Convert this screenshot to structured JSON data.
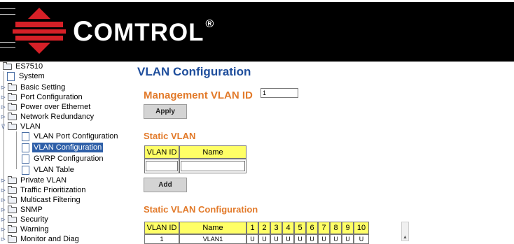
{
  "header": {
    "brand_initial": "C",
    "brand_rest": "OMTROL",
    "brand_mark": "®"
  },
  "tree": {
    "root": "ES7510",
    "items": [
      {
        "label": "System",
        "icon": "page-icon"
      },
      {
        "label": "Basic Setting",
        "icon": "folder-icon"
      },
      {
        "label": "Port Configuration",
        "icon": "folder-icon"
      },
      {
        "label": "Power over Ethernet",
        "icon": "folder-icon"
      },
      {
        "label": "Network Redundancy",
        "icon": "folder-icon"
      },
      {
        "label": "VLAN",
        "icon": "folder-open-icon"
      },
      {
        "label": "VLAN Port Configuration",
        "icon": "page-icon"
      },
      {
        "label": "VLAN Configuration",
        "icon": "page-icon",
        "selected": true
      },
      {
        "label": "GVRP Configuration",
        "icon": "page-icon"
      },
      {
        "label": "VLAN Table",
        "icon": "page-icon"
      },
      {
        "label": "Private VLAN",
        "icon": "folder-icon"
      },
      {
        "label": "Traffic Prioritization",
        "icon": "folder-icon"
      },
      {
        "label": "Multicast Filtering",
        "icon": "folder-icon"
      },
      {
        "label": "SNMP",
        "icon": "folder-icon"
      },
      {
        "label": "Security",
        "icon": "folder-icon"
      },
      {
        "label": "Warning",
        "icon": "folder-icon"
      },
      {
        "label": "Monitor and Diag",
        "icon": "folder-icon"
      }
    ]
  },
  "main": {
    "title": "VLAN Configuration",
    "mgmt_label": "Management VLAN ID",
    "mgmt_value": "1",
    "apply_label": "Apply",
    "static_vlan_title": "Static VLAN",
    "static_table": {
      "headers": [
        "VLAN ID",
        "Name"
      ]
    },
    "add_label": "Add",
    "static_config_title": "Static VLAN Configuration",
    "config_table": {
      "headers": [
        "VLAN ID",
        "Name",
        "1",
        "2",
        "3",
        "4",
        "5",
        "6",
        "7",
        "8",
        "9",
        "10"
      ],
      "row": {
        "vlan_id": "1",
        "name": "VLAN1",
        "cell": "U"
      }
    }
  },
  "colors": {
    "accent_red": "#d62027",
    "title_blue": "#1f4e9c",
    "section_orange": "#e27a2a",
    "header_yellow": "#ffff66",
    "selection_blue": "#2e5fa8"
  }
}
